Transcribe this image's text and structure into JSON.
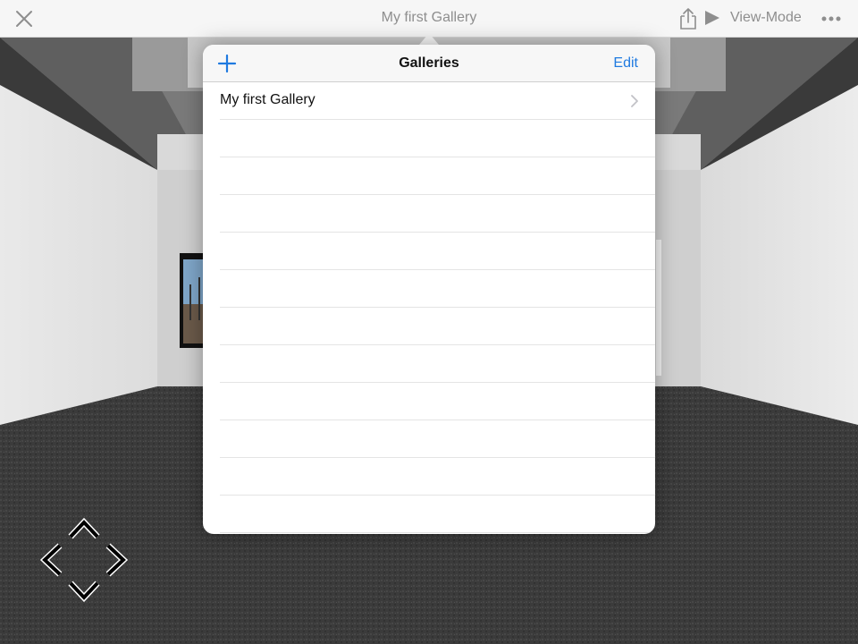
{
  "topbar": {
    "title": "My first Gallery",
    "view_mode_label": "View-Mode",
    "icons": [
      "close-icon",
      "share-icon",
      "play-icon",
      "more-icon"
    ]
  },
  "popover": {
    "title": "Galleries",
    "edit_label": "Edit",
    "add_icon": "plus-icon",
    "items": [
      {
        "label": "My first Gallery"
      }
    ],
    "accent_color": "#1f7ae0"
  },
  "navigation": {
    "icons": [
      "arrow-up-icon",
      "arrow-left-icon",
      "arrow-right-icon",
      "arrow-down-icon"
    ]
  }
}
